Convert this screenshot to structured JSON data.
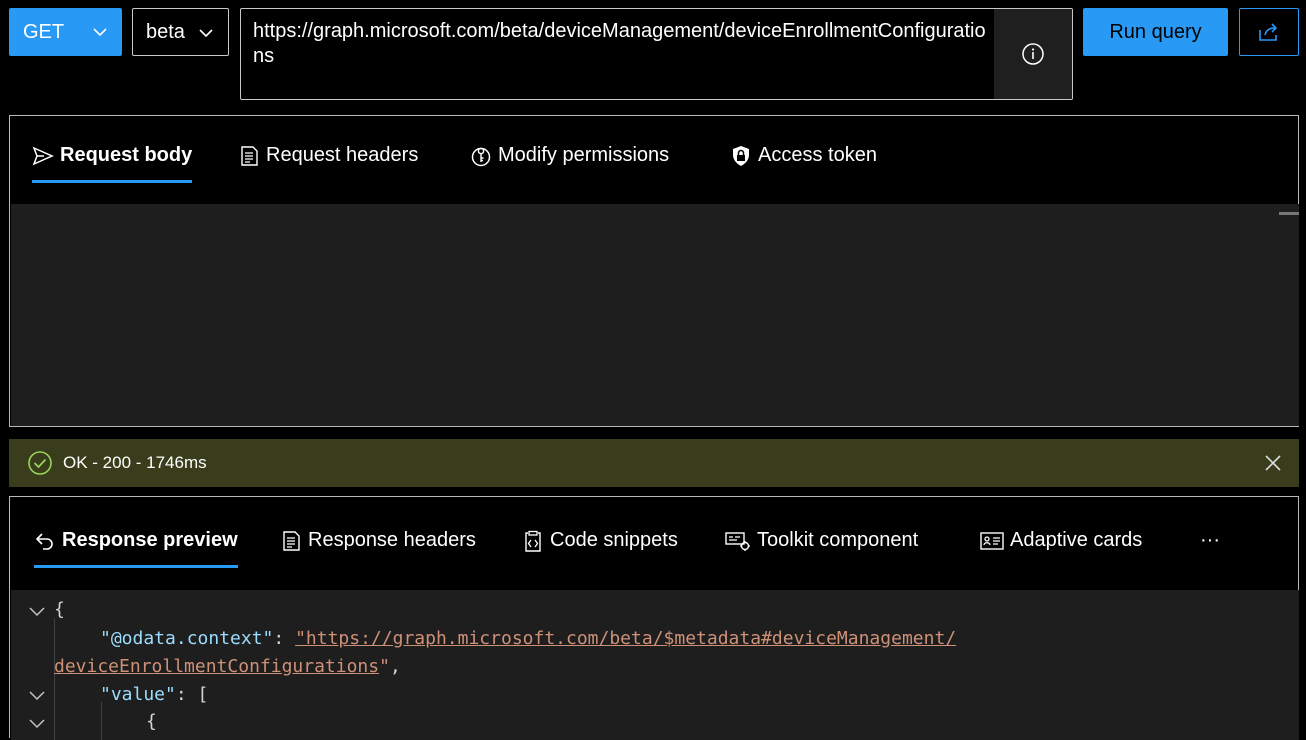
{
  "query": {
    "method": "GET",
    "version": "beta",
    "url": "https://graph.microsoft.com/beta/deviceManagement/deviceEnrollmentConfigurations",
    "run_label": "Run query"
  },
  "request_tabs": [
    {
      "label": "Request body",
      "icon": "send-icon",
      "active": true
    },
    {
      "label": "Request headers",
      "icon": "document-icon",
      "active": false
    },
    {
      "label": "Modify permissions",
      "icon": "key-shield-icon",
      "active": false
    },
    {
      "label": "Access token",
      "icon": "lock-shield-icon",
      "active": false
    }
  ],
  "status": {
    "text": "OK - 200 - 1746ms",
    "color": "#393d1b"
  },
  "response_tabs": [
    {
      "label": "Response preview",
      "icon": "undo-arrow-icon",
      "active": true
    },
    {
      "label": "Response headers",
      "icon": "document-icon",
      "active": false
    },
    {
      "label": "Code snippets",
      "icon": "clipboard-code-icon",
      "active": false
    },
    {
      "label": "Toolkit component",
      "icon": "toolkit-icon",
      "active": false
    },
    {
      "label": "Adaptive cards",
      "icon": "card-icon",
      "active": false
    },
    {
      "label": "···",
      "icon": "more-icon",
      "active": false
    }
  ],
  "response_code": {
    "open_brace": "{",
    "context_key": "\"@odata.context\"",
    "colon": ": ",
    "context_value_1": "\"https://graph.microsoft.com/beta/$metadata#deviceManagement/",
    "context_value_2": "deviceEnrollmentConfigurations",
    "context_value_end": "\"",
    "comma": ",",
    "value_key": "\"value\"",
    "value_open": ": [",
    "item_open": "{"
  },
  "colors": {
    "accent": "#2899f5",
    "editor_bg": "#1e1e1e",
    "json_key": "#9cdcfe",
    "json_string": "#ce9178"
  }
}
